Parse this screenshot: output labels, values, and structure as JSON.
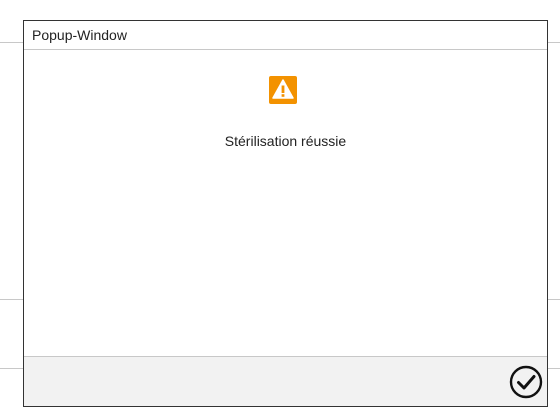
{
  "popup": {
    "title": "Popup-Window",
    "message": "Stérilisation réussie",
    "icon": "warning-icon",
    "confirm_icon": "checkmark-circle-icon"
  },
  "colors": {
    "warning_accent": "#f39200",
    "frame_border": "#333333",
    "footer_background": "#f2f2f2",
    "divider": "#c8c8c8"
  }
}
